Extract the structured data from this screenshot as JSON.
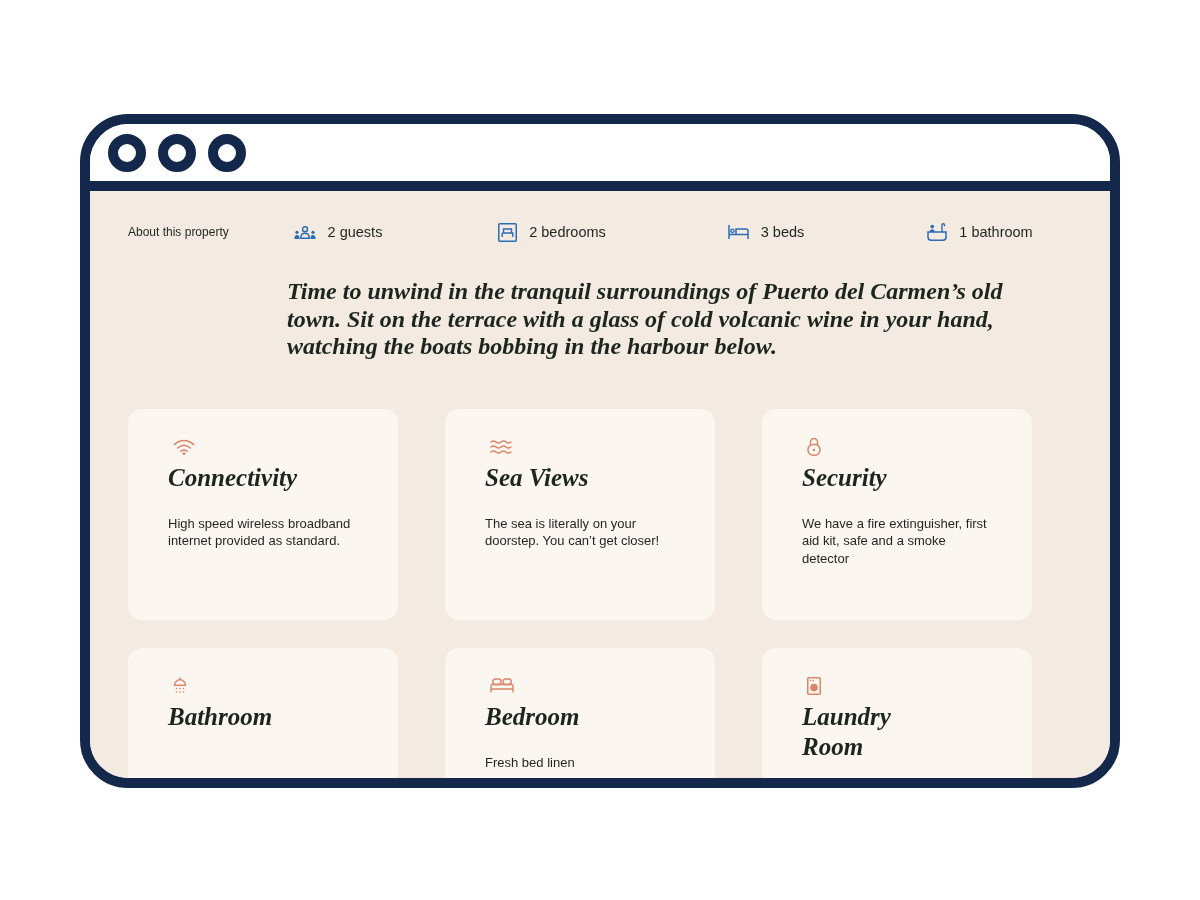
{
  "property": {
    "label": "About this property",
    "stats": [
      {
        "kind": "guests",
        "text": "2 guests"
      },
      {
        "kind": "bedrooms",
        "text": "2 bedrooms"
      },
      {
        "kind": "beds",
        "text": "3 beds"
      },
      {
        "kind": "bathrooms",
        "text": "1 bathroom"
      }
    ]
  },
  "intro": "Time to unwind in the tranquil surroundings of Puerto del Carmen’s old town. Sit on the terrace with a glass of cold volcanic wine in your hand, watching the boats bobbing in the harbour below.",
  "amenities": [
    {
      "kind": "connectivity",
      "title": "Connectivity",
      "description": "High speed wireless broadband internet provided as standard."
    },
    {
      "kind": "view",
      "title": "Sea Views",
      "description": "The sea is literally on your doorstep. You can’t get closer!"
    },
    {
      "kind": "security",
      "title": "Security",
      "description": "We have a fire extinguisher, first aid kit, safe and a smoke detector"
    },
    {
      "kind": "bathroom",
      "title": "Bathroom"
    },
    {
      "kind": "bedroom",
      "title": "Bedroom",
      "description": "Fresh bed linen"
    },
    {
      "kind": "laundry",
      "title": "Laundry Room"
    }
  ]
}
